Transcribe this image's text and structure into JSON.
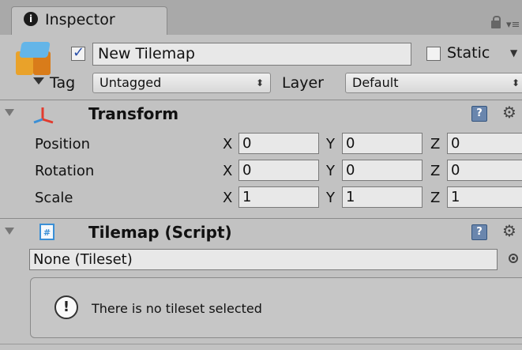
{
  "tab": {
    "label": "Inspector",
    "icon": "info-icon"
  },
  "gameobject": {
    "active": true,
    "name": "New Tilemap",
    "static_label": "Static",
    "static_checked": false
  },
  "tag": {
    "label": "Tag",
    "value": "Untagged"
  },
  "layer": {
    "label": "Layer",
    "value": "Default"
  },
  "transform": {
    "title": "Transform",
    "rows": [
      {
        "label": "Position",
        "x": "0",
        "y": "0",
        "z": "0"
      },
      {
        "label": "Rotation",
        "x": "0",
        "y": "0",
        "z": "0"
      },
      {
        "label": "Scale",
        "x": "1",
        "y": "1",
        "z": "1"
      }
    ],
    "axis_x": "X",
    "axis_y": "Y",
    "axis_z": "Z"
  },
  "tilemap": {
    "title": "Tilemap (Script)",
    "tileset_value": "None (Tileset)",
    "help_message": "There is no tileset selected"
  },
  "colors": {
    "panel_bg": "#c2c2c2",
    "tab_bar": "#a9a9a9",
    "field_bg": "#e8e8e8",
    "transform_icon_red": "#e23b2e",
    "script_icon_blue": "#3a8fd6"
  }
}
